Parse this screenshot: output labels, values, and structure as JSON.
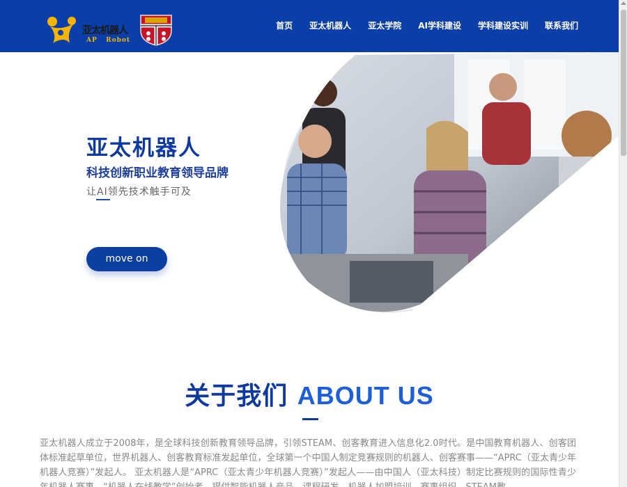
{
  "header": {
    "logo_name": "亚太机器人",
    "logo_sub": "AP   Robot",
    "nav": [
      "首页",
      "亚太机器人",
      "亚太学院",
      "AI学科建设",
      "学科建设实训",
      "联系我们"
    ]
  },
  "hero": {
    "title": "亚太机器人",
    "subtitle": "科技创新职业教育领导品牌",
    "tagline": "让AI领先技术触手可及",
    "button": "move on"
  },
  "about": {
    "title_cn": "关于我们",
    "title_en": "ABOUT US",
    "text": "亚太机器人成立于2008年，是全球科技创新教育领导品牌，引领STEAM、创客教育进入信息化2.0时代。是中国教育机器人、创客团体标准起草单位，世界机器人、创客教育标准发起单位，全球第一个中国人制定竞赛规则的机器人、创客赛事——“APRC（亚太青少年机器人竞赛）”发起人。 亚太机器人是“APRC（亚太青少年机器人竞赛）”发起人——由中国人（亚太科技）制定比赛规则的国际性青少年机器人赛事。“机器人在线教学”创始者，提供智能机器人产品、课程研发、机器人加盟培训、赛事组织、STEAM教"
  },
  "colors": {
    "header_bg": "#0a3ea8",
    "accent": "#0e3aa0",
    "accent_light": "#1d5fd6"
  }
}
